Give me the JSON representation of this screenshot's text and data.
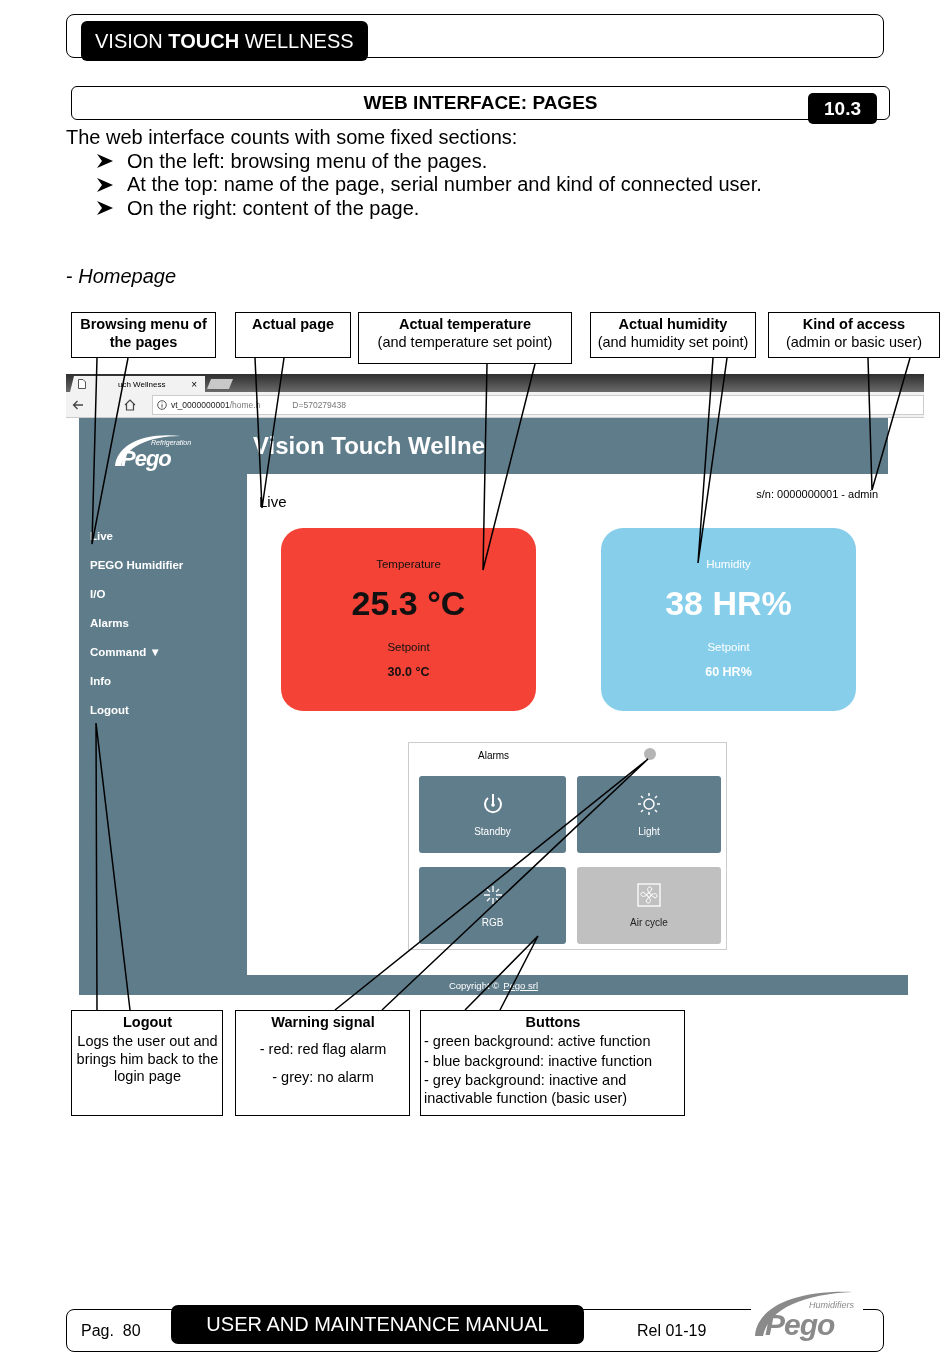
{
  "document_header": {
    "title": "VISION **TOUCH** WELLNESS"
  },
  "section_header": {
    "title": "WEB INTERFACE: PAGES",
    "number": "10.3"
  },
  "intro": {
    "text": "The web interface counts with some fixed sections:",
    "bullets": [
      "On the left: browsing menu of the pages.",
      "At the top: name of the page, serial number and kind of connected user.",
      "On the right: content of the page."
    ]
  },
  "subsection": "- *Homepage*",
  "screenshot": {
    "browser": {
      "tab_title": "uch Wellness",
      "tab_close": "×",
      "url_host": "vt_0000000001",
      "url_path": "/home.h",
      "url_tail": "D=570279438"
    },
    "logo": {
      "tagline": "Refrigeration",
      "brand": "Pego"
    },
    "page_title": "Vision Touch Wellne",
    "menu": [
      "Live",
      "PEGO Humidifier",
      "I/O",
      "Alarms",
      "Command ▼",
      "Info",
      "Logout"
    ],
    "current_page": "Live",
    "serial": "s/n: 0000000001 - admin",
    "cards": [
      {
        "kind": "temperature",
        "label": "Temperature",
        "value": "25.3 °C",
        "setpoint_label": "Setpoint",
        "setpoint": "30.0 °C"
      },
      {
        "kind": "humidity",
        "label": "Humidity",
        "value": "38 HR%",
        "setpoint_label": "Setpoint",
        "setpoint": "60 HR%"
      }
    ],
    "alarms": {
      "label": "Alarms",
      "alarm": false
    },
    "buttons": [
      {
        "label": "Standby",
        "kind": "power",
        "active": false,
        "disabled": false
      },
      {
        "label": "Light",
        "kind": "light",
        "active": false,
        "disabled": false
      },
      {
        "label": "RGB",
        "kind": "rgb",
        "active": false,
        "disabled": false
      },
      {
        "label": "Air cycle",
        "kind": "fan",
        "active": false,
        "disabled": true
      }
    ],
    "footer": {
      "text": "Copyright ©",
      "link": "Pego srl"
    }
  },
  "callouts_top": [
    {
      "title": "Browsing menu of the pages"
    },
    {
      "title": "Actual page"
    },
    {
      "title": "Actual temperature",
      "note": "(and temperature set point)"
    },
    {
      "title": "Actual humidity",
      "note": "(and humidity set point)"
    },
    {
      "title": "Kind of access",
      "note": "(admin or basic user)"
    }
  ],
  "callouts_bottom": [
    {
      "title": "Logout",
      "lines": [
        "Logs the user out and brings him back to the login page"
      ]
    },
    {
      "title": "Warning signal",
      "lines": [
        "- red: red flag alarm",
        "- grey: no alarm"
      ]
    },
    {
      "title": "Buttons",
      "lines": [
        "- green background: active function",
        "- blue background: inactive function",
        "- grey background: inactive and inactivable function (basic user)"
      ]
    }
  ],
  "page_footer": {
    "page": "Pag.  80",
    "manual": "USER AND MAINTENANCE MANUAL",
    "release": "Rel 01-19",
    "logo_tagline": "Humidifiers",
    "logo_brand": "Pego"
  }
}
